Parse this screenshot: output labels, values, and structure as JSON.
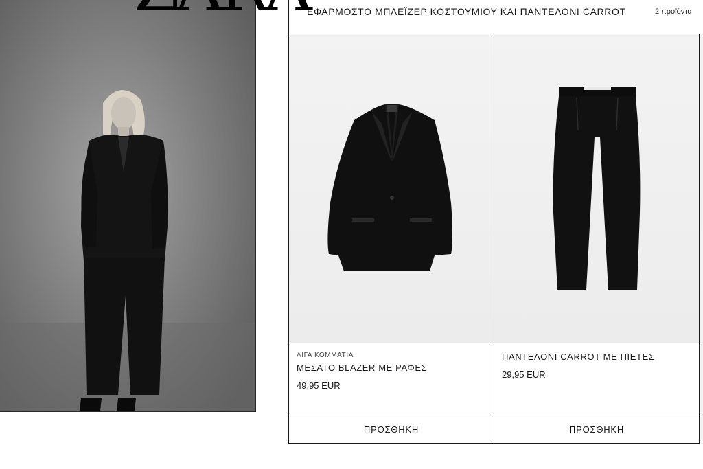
{
  "brand": {
    "logo_text": "ZARA"
  },
  "look": {
    "title": "ΕΦΑΡΜΟΣΤΟ ΜΠΛΕΪΖΕΡ ΚΟΣΤΟΥΜΙΟΥ ΚΑΙ ΠΑΝΤΕΛΟΝΙ CARROT",
    "count": "2 προϊόντα"
  },
  "products": [
    {
      "tag": "ΛΙΓΑ ΚΟΜΜΑΤΙΑ",
      "name": "ΜΕΣΑΤΟ BLAZER ΜΕ ΡΑΦΕΣ",
      "price": "49,95 EUR",
      "add_label": "ΠΡΟΣΘΗΚΗ"
    },
    {
      "tag": "",
      "name": "ΠΑΝΤΕΛΟΝΙ CARROT ΜΕ ΠΙΕΤΕΣ",
      "price": "29,95 EUR",
      "add_label": "ΠΡΟΣΘΗΚΗ"
    }
  ]
}
